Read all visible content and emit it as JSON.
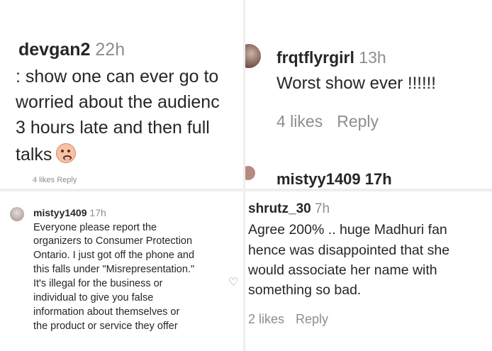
{
  "panel1": {
    "username": "devgan2",
    "time": "22h",
    "lines": [
      ": show one can ever go to",
      "worried about the audienc",
      " 3 hours late and then full",
      "talks"
    ],
    "emoji_icon": "anxious-face-emoji",
    "cut_meta": "4 likes   Reply"
  },
  "panel2": {
    "username": "frqtflyrgirl",
    "time": "13h",
    "text": "Worst show ever !!!!!!",
    "likes": "4 likes",
    "reply": "Reply",
    "cut_user": "mistyy1409 17h"
  },
  "panel3": {
    "username": "mistyy1409",
    "time": "17h",
    "lines": [
      "Everyone please report the",
      "organizers to Consumer Protection",
      "Ontario. I just got off the phone and",
      "this falls under \"Misrepresentation.\"",
      "It's illegal for the business or",
      "individual to give you false",
      "information about themselves or",
      "the product or service they offer"
    ],
    "heart_icon": "heart-outline-icon"
  },
  "panel4": {
    "username": "shrutz_30",
    "time": "7h",
    "lines": [
      "Agree 200% .. huge Madhuri fan",
      "hence was disappointed that she",
      "would associate her name with",
      "something so bad."
    ],
    "likes": "2 likes",
    "reply": "Reply"
  }
}
